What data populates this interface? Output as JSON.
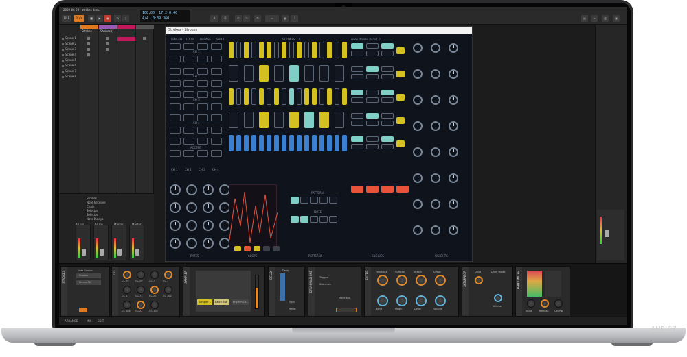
{
  "window": {
    "project_title": "2022-06-29 - strokes dem..",
    "time_bars": "17.2.0.40",
    "time_secs": "0:39.360",
    "tempo": "100.00",
    "signature": "4/4",
    "file_label": "FILE",
    "play_label": "PLAY",
    "arrange_label": "ARRANGE",
    "mix_label": "MIX",
    "edit_label": "EDIT"
  },
  "scenes": [
    "Scene 1",
    "Scene 2",
    "Scene 3",
    "Scene 4",
    "Scene 5",
    "Scene 6",
    "Scene 7",
    "Scene 8"
  ],
  "tracks": [
    "Strokes",
    "Strokes (...",
    ""
  ],
  "browser_items": [
    "Strokes",
    "Note Receiver",
    "Chain",
    "Selector",
    "Selector",
    "Note Delays"
  ],
  "mixer_channels": [
    "All Ins",
    "All Ins",
    "Master",
    "Master"
  ],
  "plugin": {
    "title": "Strokes - Strokes",
    "top_labels": [
      "LENGTH",
      "LOOP",
      "PHRASE",
      "SHIFT"
    ],
    "strokes_label": "STROKES 1.0",
    "url_label": "www.strokes.io / v1.0",
    "channels": [
      "CH 1",
      "CH 2",
      "CH 3",
      "CH 4",
      "ACCENT"
    ],
    "lfo_labels": [
      "CH 1",
      "CH 2",
      "CH 3",
      "CH 4"
    ],
    "pattern_label": "PATTERN",
    "note_label": "NOTE",
    "sections": [
      "RATES",
      "SCOPE",
      "PATTERNS",
      "ENGINES",
      "WEIGHTS"
    ],
    "colors": {
      "yellow": "#d4c021",
      "teal": "#7fcfc6",
      "blue": "#3a7fd0",
      "red": "#e8533a",
      "bg": "#0f131c"
    }
  },
  "devices": [
    {
      "name": "STROKES",
      "label_a": "Note Source",
      "label_b": "Strokes",
      "label_c": "Stereo FX"
    },
    {
      "name": "CC",
      "knobs": [
        "CC 29",
        "CC 29",
        "CC 7",
        "CC 7",
        "CC 1",
        "CC 71",
        "CC 22",
        "CC 102",
        "CC 104",
        "CC 22",
        "CC 104"
      ]
    },
    {
      "name": "SAMPLER",
      "label_a": "Sampler 1",
      "label_b": "Batch Bus",
      "label_c": "Rhythm Co..."
    },
    {
      "name": "DELAY",
      "label_a": "Delay",
      "label_b": "Sync",
      "label_c": "Reset"
    },
    {
      "name": "DRUM MACHINE",
      "label_a": "Trigger",
      "label_b": "Sidechain",
      "label_c": "Mode 808"
    },
    {
      "name": "FILTER",
      "knobs": [
        "Feedback",
        "Subtract",
        "Attack",
        "Decay",
        "Band",
        "Magic",
        "Delay",
        "Volume"
      ]
    },
    {
      "name": "SATURATOR",
      "label_a": "Drive",
      "label_b": "Drive mode",
      "label_c": "Volume"
    },
    {
      "name": "PEAK LIMITER",
      "label_a": "Input",
      "label_b": "Release",
      "label_c": "Ceiling"
    }
  ],
  "watermark": "AUDIOZ"
}
